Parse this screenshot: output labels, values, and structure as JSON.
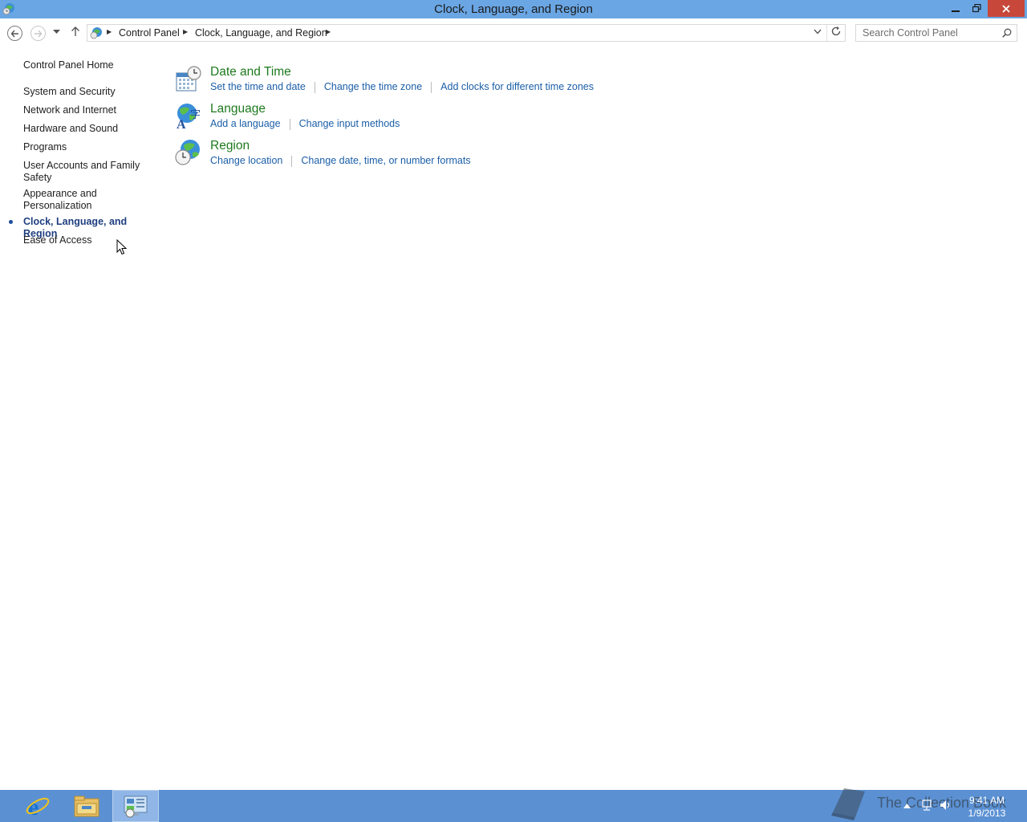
{
  "window": {
    "title": "Clock, Language, and Region",
    "minimize_icon": "minimize-icon",
    "maximize_icon": "restore-icon",
    "close_icon": "close-icon",
    "titlebar_color": "#6aa6e4",
    "close_color": "#c7473a"
  },
  "navigation": {
    "breadcrumbs": [
      "Control Panel",
      "Clock, Language, and Region"
    ],
    "search_placeholder": "Search Control Panel"
  },
  "sidebar": {
    "items": [
      {
        "label": "Control Panel Home"
      },
      {
        "label": "System and Security"
      },
      {
        "label": "Network and Internet"
      },
      {
        "label": "Hardware and Sound"
      },
      {
        "label": "Programs"
      },
      {
        "label": "User Accounts and Family Safety"
      },
      {
        "label": "Appearance and Personalization"
      },
      {
        "label": "Clock, Language, and Region",
        "current": true
      },
      {
        "label": "Ease of Access"
      }
    ]
  },
  "categories": [
    {
      "title": "Date and Time",
      "icon": "calendar-clock-icon",
      "links": [
        "Set the time and date",
        "Change the time zone",
        "Add clocks for different time zones"
      ]
    },
    {
      "title": "Language",
      "icon": "language-globe-icon",
      "links": [
        "Add a language",
        "Change input methods"
      ]
    },
    {
      "title": "Region",
      "icon": "region-globe-clock-icon",
      "links": [
        "Change location",
        "Change date, time, or number formats"
      ]
    }
  ],
  "colors": {
    "category_title": "#1e7a1e",
    "link": "#1b5ea8",
    "taskbar": "#5b91d3"
  },
  "taskbar": {
    "apps": [
      "internet-explorer-icon",
      "file-explorer-icon",
      "control-panel-icon"
    ],
    "watermark_text": "The Collection Book",
    "clock_time": "9:41 AM",
    "clock_date": "1/9/2013"
  }
}
